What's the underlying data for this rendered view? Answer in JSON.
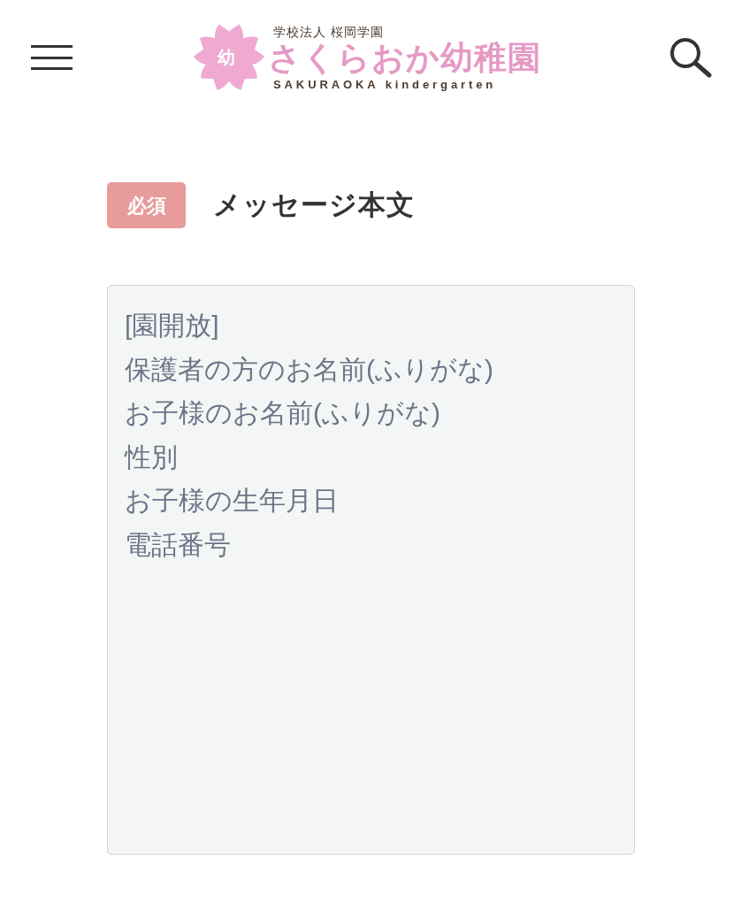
{
  "logo": {
    "emblem_text": "幼",
    "subtitle": "学校法人 桜岡学園",
    "name": "さくらおか幼稚園",
    "romaji": "SAKURAOKA kindergarten"
  },
  "field": {
    "required": true,
    "required_badge": "必須",
    "label": "メッセージ本文",
    "placeholder_lines": [
      "[園開放]",
      "保護者の方のお名前(ふりがな)",
      "お子様のお名前(ふりがな)",
      "性別",
      "お子様の生年月日",
      "電話番号"
    ]
  }
}
